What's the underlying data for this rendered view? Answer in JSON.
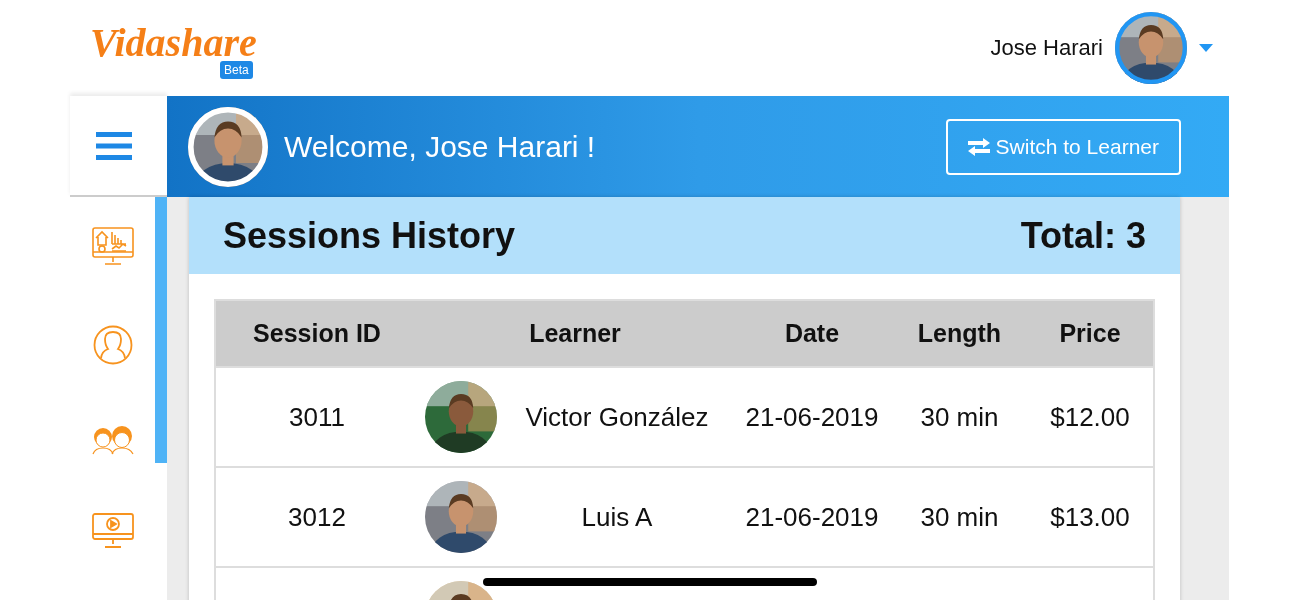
{
  "header": {
    "logo": "Vidashare",
    "badge": "Beta",
    "user_name": "Jose Harari"
  },
  "banner": {
    "welcome": "Welcome, Jose Harari !",
    "switch_button": "Switch to Learner"
  },
  "sessions": {
    "title": "Sessions History",
    "total": "Total: 3",
    "columns": [
      "Session ID",
      "Learner",
      "Date",
      "Length",
      "Price"
    ],
    "rows": [
      {
        "session_id": "3011",
        "photo": {
          "kind": "picture"
        },
        "learner": "Victor González",
        "date": "21-06-2019",
        "length": "30 min",
        "price": "$12.00"
      },
      {
        "session_id": "3012",
        "photo": {
          "kind": "picture"
        },
        "learner": "Luis A",
        "date": "21-06-2019",
        "length": "30 min",
        "price": "$13.00"
      },
      {
        "photo": {
          "kind": "picture"
        }
      }
    ]
  }
}
